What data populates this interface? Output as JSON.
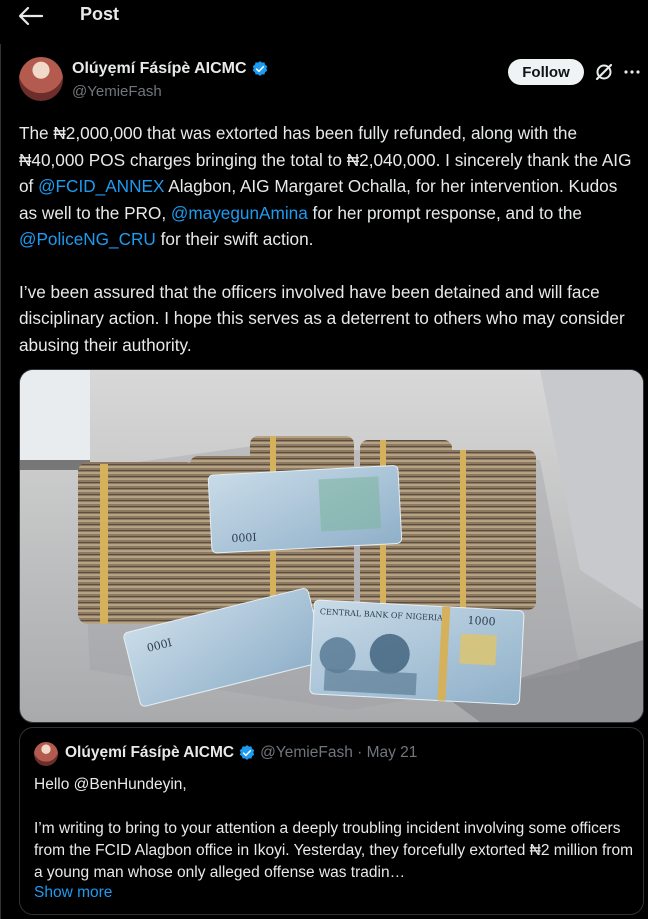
{
  "header": {
    "title": "Post"
  },
  "post": {
    "author_name": "Olúyẹmí Fásípè AICMC",
    "handle": "@YemieFash",
    "follow_label": "Follow",
    "para1": [
      "The ₦2,000,000 that was extorted has been fully refunded, along with the ₦40,000 POS charges bringing the total to ₦2,040,000. I sincerely thank the AIG of ",
      "@FCID_ANNEX",
      " Alagbon, AIG Margaret Ochalla, for her intervention. Kudos as well to the PRO, ",
      "@mayegunAmina",
      " for her prompt response, and to the ",
      "@PoliceNG_CRU",
      " for their swift action."
    ],
    "para2": "I’ve been assured that the officers involved have been detained and will face disciplinary action. I hope this serves as a deterrent to others who may consider abusing their authority.",
    "image_label_1": "CENTRAL BANK OF NIGERIA",
    "image_label_2": "1000"
  },
  "quote": {
    "author_name": "Olúyẹmí Fásípè AICMC",
    "meta": "@YemieFash · May 21",
    "line1": "Hello @BenHundeyin,",
    "line2": "I’m writing to bring to your attention a deeply troubling incident involving some officers from the FCID Alagbon office in Ikoyi. Yesterday, they forcefully extorted ₦2 million from a young man whose only alleged offense was tradin…",
    "show_more": "Show more"
  },
  "colors": {
    "accent": "#1d9bf0",
    "background": "#000000",
    "muted": "#71767b"
  }
}
